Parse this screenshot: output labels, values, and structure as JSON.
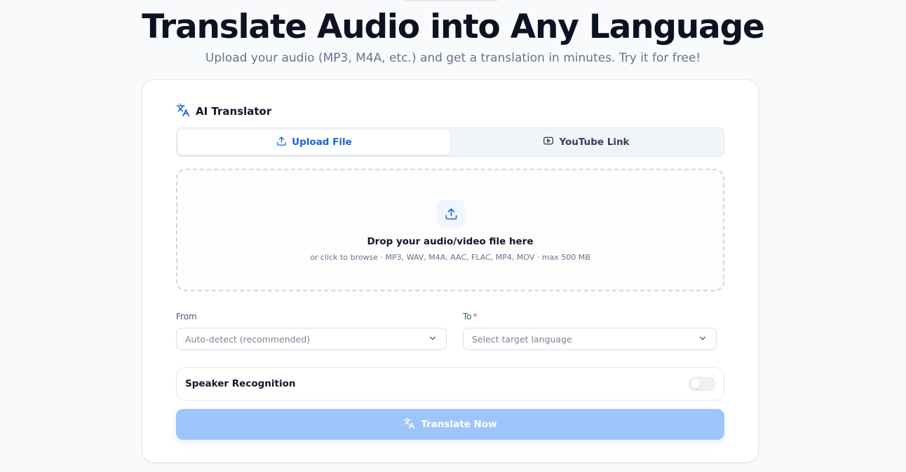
{
  "hero": {
    "title": "Translate Audio into Any Language",
    "subtitle": "Upload your audio (MP3, M4A, etc.) and get a translation in minutes. Try it for free!"
  },
  "card": {
    "title": "AI Translator",
    "icon": "translate-icon",
    "tabs": [
      {
        "label": "Upload File",
        "icon": "upload-icon",
        "active": true
      },
      {
        "label": "YouTube Link",
        "icon": "youtube-icon",
        "active": false
      }
    ]
  },
  "dropzone": {
    "icon": "upload-icon",
    "title": "Drop your audio/video file here",
    "hint": "or click to browse · MP3, WAV, M4A, AAC, FLAC, MP4, MOV · max 500 MB"
  },
  "languages": {
    "from": {
      "label": "From",
      "value": "Auto-detect (recommended)"
    },
    "to": {
      "label": "To",
      "required_mark": "*",
      "placeholder": "Select target language"
    }
  },
  "speaker_recognition": {
    "label": "Speaker Recognition",
    "enabled": false
  },
  "action": {
    "label": "Translate Now",
    "icon": "translate-icon"
  },
  "colors": {
    "accent": "#1d63d8",
    "button_disabled": "#9ec5fb",
    "required": "#ef4444"
  }
}
